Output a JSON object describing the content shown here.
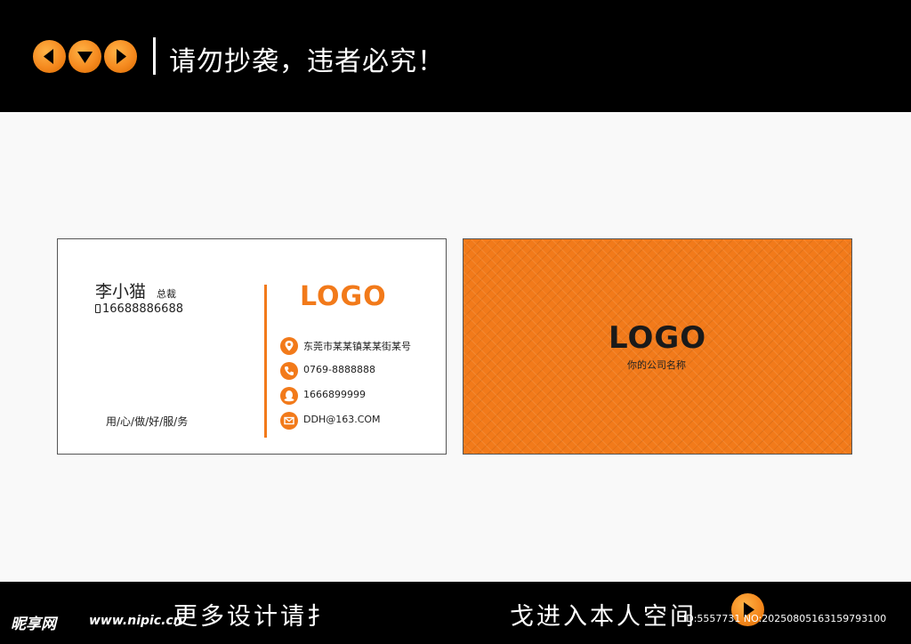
{
  "header": {
    "warning": "请勿抄袭，违者必究！",
    "nav_buttons": [
      "arrow-left-icon",
      "arrow-down-icon",
      "arrow-right-icon"
    ]
  },
  "card_front": {
    "name": "李小猫",
    "title": "总裁",
    "phone": "16688886688",
    "slogan": "用/心/做/好/服/务",
    "logo": "LOGO",
    "contacts": [
      {
        "icon": "location-pin-icon",
        "text": "东莞市某某镇某某街某号"
      },
      {
        "icon": "telephone-icon",
        "text": "0769-8888888"
      },
      {
        "icon": "qq-icon",
        "text": "1666899999"
      },
      {
        "icon": "email-icon",
        "text": "DDH@163.COM"
      }
    ]
  },
  "card_back": {
    "logo": "LOGO",
    "company": "你的公司名称"
  },
  "footer": {
    "site_name": "昵享网",
    "site_url": "www.nipic.cn",
    "more_left": "更多设计请扌",
    "more_right": "戈进入本人空间",
    "watermark_id": "ID:5557731 NO:20250805163159793100"
  },
  "colors": {
    "accent": "#f27a1a",
    "bar": "#000000",
    "page": "#f9f9f9"
  }
}
